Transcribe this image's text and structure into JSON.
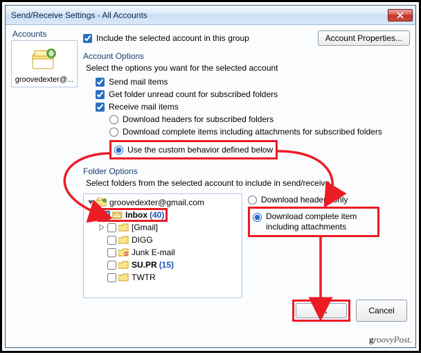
{
  "window": {
    "title": "Send/Receive Settings - All Accounts"
  },
  "accounts": {
    "header": "Accounts",
    "items": [
      {
        "name": "groovedexter@..."
      }
    ]
  },
  "include_group": {
    "label": "Include the selected account in this group",
    "checked": true
  },
  "buttons": {
    "account_properties": "Account Properties...",
    "ok": "OK",
    "cancel": "Cancel"
  },
  "account_options": {
    "title": "Account Options",
    "desc": "Select the options you want for the selected account",
    "send_mail": {
      "label": "Send mail items",
      "checked": true
    },
    "unread_count": {
      "label": "Get folder unread count for subscribed folders",
      "checked": true
    },
    "receive_mail": {
      "label": "Receive mail items",
      "checked": true
    },
    "radios": {
      "headers_sub": {
        "label": "Download headers for subscribed folders",
        "selected": false
      },
      "complete_sub": {
        "label": "Download complete items including attachments for subscribed folders",
        "selected": false
      },
      "custom": {
        "label": "Use the custom behavior defined below",
        "selected": true
      }
    }
  },
  "folder_options": {
    "title": "Folder Options",
    "desc": "Select folders from the selected account to include in send/receive",
    "tree": {
      "root": {
        "label": "groovedexter@gmail.com"
      },
      "items": [
        {
          "label": "Inbox",
          "count": "(40)",
          "checked": true,
          "bold": true,
          "expander": "closed"
        },
        {
          "label": "[Gmail]",
          "checked": false,
          "bold": false,
          "expander": "closed"
        },
        {
          "label": "DIGG",
          "checked": false
        },
        {
          "label": "Junk E-mail",
          "checked": false
        },
        {
          "label": "SU.PR",
          "count": "(15)",
          "checked": false,
          "bold": true
        },
        {
          "label": "TWTR",
          "checked": false
        }
      ]
    },
    "download": {
      "headers_only": {
        "label": "Download headers only",
        "selected": false
      },
      "complete": {
        "label": "Download complete item including attachments",
        "selected": true
      }
    }
  },
  "watermark": "groovyPost."
}
